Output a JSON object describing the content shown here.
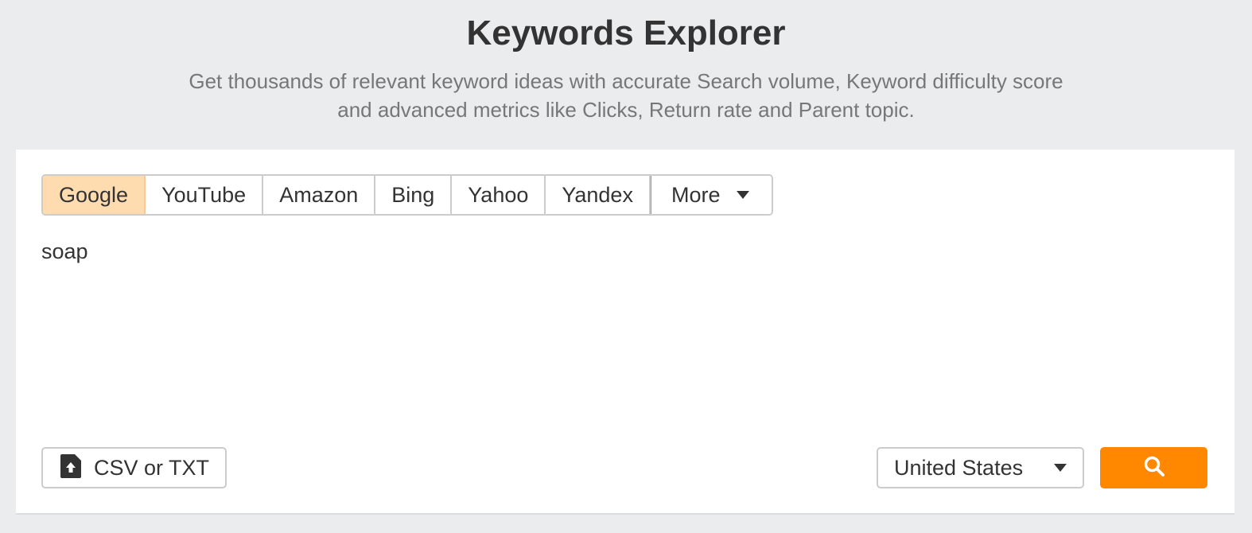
{
  "header": {
    "title": "Keywords Explorer",
    "subtitle": "Get thousands of relevant keyword ideas with accurate Search volume, Keyword difficulty score and advanced metrics like Clicks, Return rate and Parent topic."
  },
  "search_engines": {
    "tabs": [
      {
        "label": "Google",
        "active": true
      },
      {
        "label": "YouTube",
        "active": false
      },
      {
        "label": "Amazon",
        "active": false
      },
      {
        "label": "Bing",
        "active": false
      },
      {
        "label": "Yahoo",
        "active": false
      },
      {
        "label": "Yandex",
        "active": false
      }
    ],
    "more_label": "More"
  },
  "query": {
    "value": "soap"
  },
  "upload": {
    "label": "CSV or TXT",
    "icon": "file-upload-icon"
  },
  "country": {
    "selected": "United States"
  },
  "search_button": {
    "icon": "search-icon"
  },
  "colors": {
    "accent": "#ff8800",
    "active_tab_bg": "#fedcb0",
    "page_bg": "#ebecee"
  }
}
